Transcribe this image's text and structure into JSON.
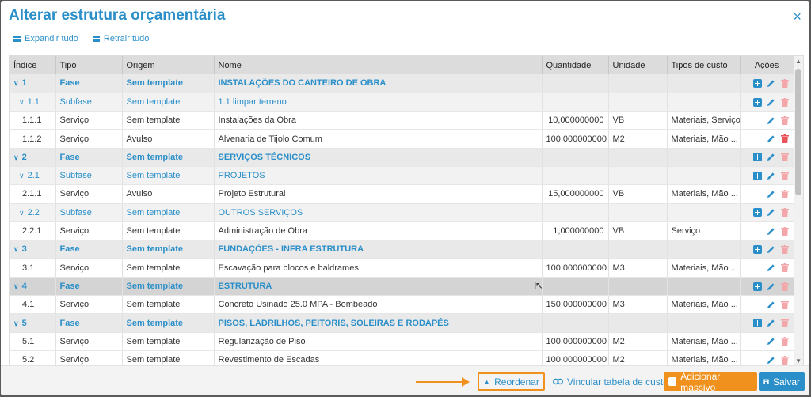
{
  "modal": {
    "title": "Alterar estrutura orçamentária",
    "close_icon": "×"
  },
  "toolbar": {
    "expand_label": "Expandir tudo",
    "collapse_label": "Retrair tudo"
  },
  "columns": [
    "Índice",
    "Tipo",
    "Origem",
    "Nome",
    "Quantidade",
    "Unidade",
    "Tipos de custo",
    "Ações"
  ],
  "rows": [
    {
      "level": "fase",
      "chev": "∨",
      "indice": "1",
      "tipo": "Fase",
      "origem": "Sem template",
      "nome": "INSTALAÇÕES DO CANTEIRO DE OBRA",
      "qtd": "",
      "un": "",
      "custo": "",
      "add": true,
      "del_active": false
    },
    {
      "level": "subfase",
      "chev": "∨",
      "indice": "1.1",
      "tipo": "Subfase",
      "origem": "Sem template",
      "nome": "1.1 limpar terreno",
      "qtd": "",
      "un": "",
      "custo": "",
      "add": true,
      "del_active": false
    },
    {
      "level": "servico",
      "chev": "",
      "indice": "1.1.1",
      "tipo": "Serviço",
      "origem": "Sem template",
      "nome": "Instalações da Obra",
      "qtd": "10,000000000",
      "un": "VB",
      "custo": "Materiais, Serviço",
      "add": false,
      "del_active": false
    },
    {
      "level": "servico",
      "chev": "",
      "indice": "1.1.2",
      "tipo": "Serviço",
      "origem": "Avulso",
      "nome": "Alvenaria de Tijolo Comum",
      "qtd": "100,000000000",
      "un": "M2",
      "custo": "Materiais, Mão ...",
      "add": false,
      "del_active": true
    },
    {
      "level": "fase",
      "chev": "∨",
      "indice": "2",
      "tipo": "Fase",
      "origem": "Sem template",
      "nome": "SERVIÇOS TÉCNICOS",
      "qtd": "",
      "un": "",
      "custo": "",
      "add": true,
      "del_active": false
    },
    {
      "level": "subfase",
      "chev": "∨",
      "indice": "2.1",
      "tipo": "Subfase",
      "origem": "Sem template",
      "nome": "PROJETOS",
      "qtd": "",
      "un": "",
      "custo": "",
      "add": true,
      "del_active": false
    },
    {
      "level": "servico",
      "chev": "",
      "indice": "2.1.1",
      "tipo": "Serviço",
      "origem": "Avulso",
      "nome": "Projeto Estrutural",
      "qtd": "15,000000000",
      "un": "VB",
      "custo": "Materiais, Mão ...",
      "add": false,
      "del_active": false
    },
    {
      "level": "subfase",
      "chev": "∨",
      "indice": "2.2",
      "tipo": "Subfase",
      "origem": "Sem template",
      "nome": "OUTROS SERVIÇOS",
      "qtd": "",
      "un": "",
      "custo": "",
      "add": true,
      "del_active": false
    },
    {
      "level": "servico",
      "chev": "",
      "indice": "2.2.1",
      "tipo": "Serviço",
      "origem": "Sem template",
      "nome": "Administração de Obra",
      "qtd": "1,000000000",
      "un": "VB",
      "custo": "Serviço",
      "add": false,
      "del_active": false
    },
    {
      "level": "fase",
      "chev": "∨",
      "indice": "3",
      "tipo": "Fase",
      "origem": "Sem template",
      "nome": "FUNDAÇÕES - INFRA ESTRUTURA",
      "qtd": "",
      "un": "",
      "custo": "",
      "add": true,
      "del_active": false
    },
    {
      "level": "servico",
      "chev": "",
      "indice": "3.1",
      "tipo": "Serviço",
      "origem": "Sem template",
      "nome": "Escavação para blocos e baldrames",
      "qtd": "100,000000000",
      "un": "M3",
      "custo": "Materiais, Mão ...",
      "add": false,
      "del_active": false
    },
    {
      "level": "fase hl",
      "chev": "∨",
      "indice": "4",
      "tipo": "Fase",
      "origem": "Sem template",
      "nome": "ESTRUTURA",
      "qtd": "",
      "un": "",
      "custo": "",
      "add": true,
      "del_active": false
    },
    {
      "level": "servico",
      "chev": "",
      "indice": "4.1",
      "tipo": "Serviço",
      "origem": "Sem template",
      "nome": "Concreto Usinado 25.0 MPA - Bombeado",
      "qtd": "150,000000000",
      "un": "M3",
      "custo": "Materiais, Mão ...",
      "add": false,
      "del_active": false
    },
    {
      "level": "fase",
      "chev": "∨",
      "indice": "5",
      "tipo": "Fase",
      "origem": "Sem template",
      "nome": "PISOS, LADRILHOS, PEITORIS, SOLEIRAS E RODAPÉS",
      "qtd": "",
      "un": "",
      "custo": "",
      "add": true,
      "del_active": false
    },
    {
      "level": "servico",
      "chev": "",
      "indice": "5.1",
      "tipo": "Serviço",
      "origem": "Sem template",
      "nome": "Regularização de Piso",
      "qtd": "100,000000000",
      "un": "M2",
      "custo": "Materiais, Mão ...",
      "add": false,
      "del_active": false
    },
    {
      "level": "servico",
      "chev": "",
      "indice": "5.2",
      "tipo": "Serviço",
      "origem": "Sem template",
      "nome": "Revestimento de Escadas",
      "qtd": "100,000000000",
      "un": "M2",
      "custo": "Materiais, Mão ...",
      "add": false,
      "del_active": false
    }
  ],
  "footer": {
    "reorder_label": "Reordenar",
    "link_label": "Vincular tabela de custo",
    "bulk_add_label": "Adicionar massivo",
    "save_label": "Salvar"
  },
  "colors": {
    "accent": "#2a8fc9",
    "orange": "#f0911d",
    "delete": "#e8545a",
    "delete_faded": "#f4a7aa"
  }
}
